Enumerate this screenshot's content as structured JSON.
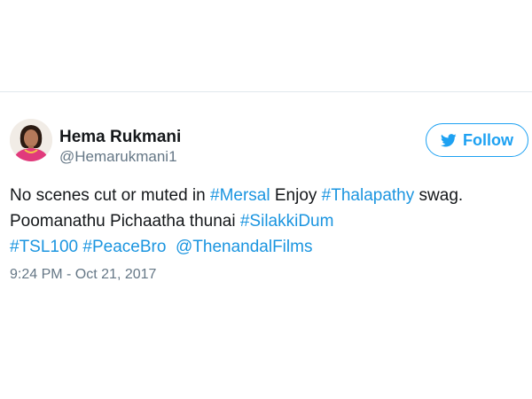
{
  "tweet": {
    "author": {
      "name": "Hema Rukmani",
      "handle": "@Hemarukmani1"
    },
    "follow_label": "Follow",
    "text_lines": [
      {
        "t1": "No scenes cut or muted in ",
        "tag1": "#Mersal",
        "t2": " Enjoy ",
        "tag2": "#Thalapathy",
        "t3": " swag."
      },
      {
        "t1": "Poomanathu Pichaatha thunai ",
        "tag1": "#SilakkiDum"
      },
      {
        "tag1": "#TSL100",
        "tag2": "#PeaceBro",
        "mention": "@ThenandalFilms"
      }
    ],
    "timestamp": "9:24 PM - Oct 21, 2017"
  },
  "colors": {
    "link": "#1b95e0",
    "brand": "#1da1f2",
    "secondary_text": "#657786",
    "divider": "#e1e8ed"
  },
  "icons": {
    "follow_button": "twitter-bird-icon"
  }
}
